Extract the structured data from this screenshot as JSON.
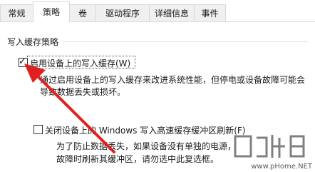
{
  "tabs": [
    {
      "label": "常规",
      "active": false
    },
    {
      "label": "策略",
      "active": true
    },
    {
      "label": "卷",
      "active": false
    },
    {
      "label": "驱动程序",
      "active": false
    },
    {
      "label": "详细信息",
      "active": false
    },
    {
      "label": "事件",
      "active": false
    }
  ],
  "group": {
    "title": "写入缓存策略"
  },
  "option1": {
    "label": "启用设备上的写入缓存(W)",
    "checked": true,
    "checkmark": "✓",
    "description_line1": "通过启用设备上的写入缓存来改进系统性能，但停电或设备故障可能会",
    "description_line2": "导致数据丢失或损坏。"
  },
  "option2": {
    "label": "关闭设备上的 Windows 写入高速缓存缓冲区刷新(F)",
    "checked": false,
    "description_line1": "为了防止数据丢失，如果设备没有单独的电源，",
    "description_line2": "故障时刷新其缓冲区，请勿选中此复选框。"
  },
  "annotation": {
    "arrow_color": "#e02020"
  },
  "watermark": {
    "url": "www.pHome.NET"
  }
}
